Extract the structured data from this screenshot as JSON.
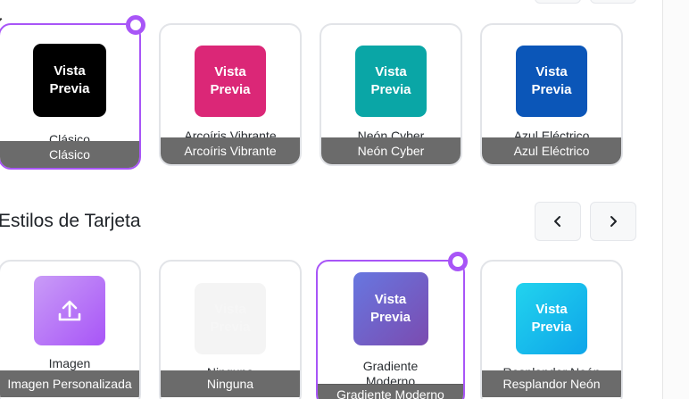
{
  "colors": {
    "accent": "#a855f7",
    "clasico": "#000000",
    "arcoiris": "#db2777",
    "neon": "#0aa6a6",
    "azul": "#0b56b8",
    "band": "#6b6b6b"
  },
  "top_nav": {
    "prev_icon": "chevron-left-icon",
    "next_icon": "chevron-right-icon"
  },
  "color_row": [
    {
      "preview": "Vista\nPrevia",
      "name": "Clásico",
      "band": "Clásico",
      "selected": true
    },
    {
      "preview": "Vista\nPrevia",
      "name": "Arcoíris Vibrante",
      "band": "Arcoíris Vibrante",
      "selected": false
    },
    {
      "preview": "Vista\nPrevia",
      "name": "Neón Cyber",
      "band": "Neón Cyber",
      "selected": false
    },
    {
      "preview": "Vista\nPrevia",
      "name": "Azul Eléctrico",
      "band": "Azul Eléctrico",
      "selected": false
    }
  ],
  "card_styles": {
    "title": "Estilos de Tarjeta",
    "prev_icon": "chevron-left-icon",
    "next_icon": "chevron-right-icon",
    "items": [
      {
        "preview_icon": "upload-icon",
        "name": "Imagen Personalizada",
        "band": "Imagen Personalizada",
        "selected": false
      },
      {
        "preview": "Vista\nPrevia",
        "name": "Ninguna",
        "band": "Ninguna",
        "selected": false
      },
      {
        "preview": "Vista\nPrevia",
        "name": "Gradiente Moderno",
        "band": "Gradiente Moderno",
        "selected": true
      },
      {
        "preview": "Vista\nPrevia",
        "name": "Resplandor Neón",
        "band": "Resplandor Neón",
        "selected": false
      }
    ]
  }
}
